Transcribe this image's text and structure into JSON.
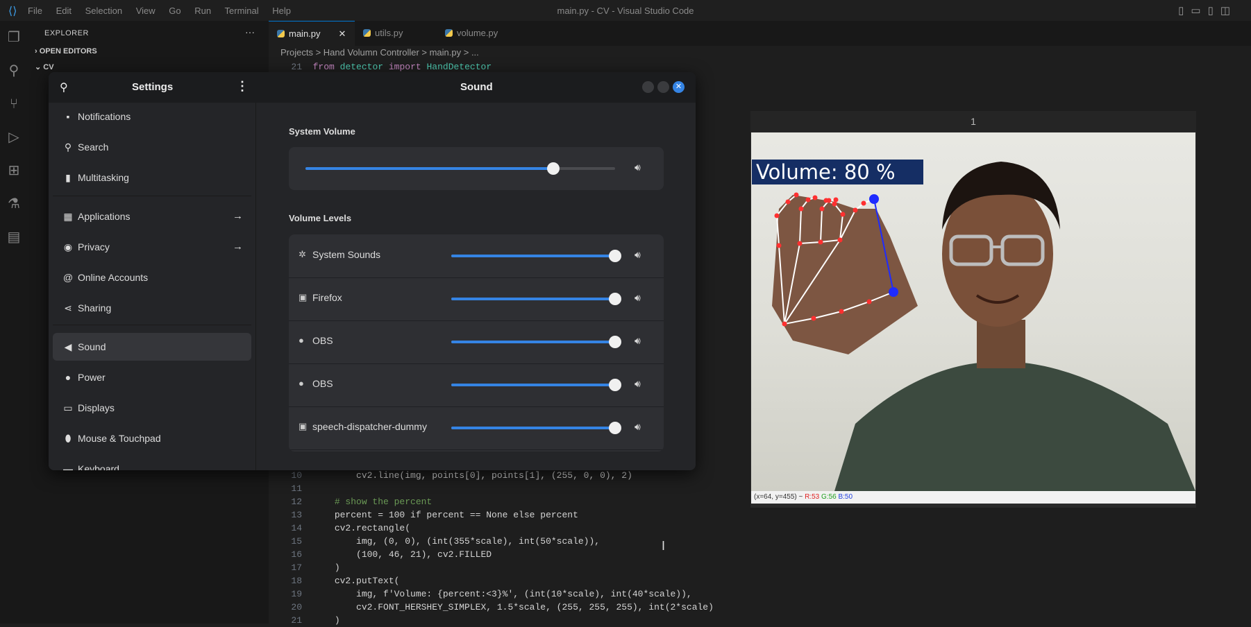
{
  "titlebar": {
    "menu": [
      "File",
      "Edit",
      "Selection",
      "View",
      "Go",
      "Run",
      "Terminal",
      "Help"
    ],
    "title": "main.py - CV - Visual Studio Code"
  },
  "activity_icons": [
    "files-icon",
    "search-icon",
    "source-control-icon",
    "run-debug-icon",
    "extensions-icon",
    "testing-icon",
    "remote-icon"
  ],
  "explorer": {
    "header": "EXPLORER",
    "open_editors": "OPEN EDITORS",
    "folder": "CV"
  },
  "tabs": [
    {
      "label": "main.py",
      "active": true
    },
    {
      "label": "utils.py",
      "active": false
    },
    {
      "label": "volume.py",
      "active": false
    }
  ],
  "breadcrumb": "Projects > Hand Volumn Controller > main.py > ...",
  "code_top": {
    "line": "21",
    "text": "from detector import HandDetector"
  },
  "code_bottom": [
    {
      "n": "10",
      "t": "        cv2.line(img, points[0], points[1], (255, 0, 0), 2)"
    },
    {
      "n": "11",
      "t": ""
    },
    {
      "n": "12",
      "t": "    # show the percent"
    },
    {
      "n": "13",
      "t": "    percent = 100 if percent == None else percent"
    },
    {
      "n": "14",
      "t": "    cv2.rectangle("
    },
    {
      "n": "15",
      "t": "        img, (0, 0), (int(355*scale), int(50*scale)),"
    },
    {
      "n": "16",
      "t": "        (100, 46, 21), cv2.FILLED"
    },
    {
      "n": "17",
      "t": "    )"
    },
    {
      "n": "18",
      "t": "    cv2.putText("
    },
    {
      "n": "19",
      "t": "        img, f'Volume: {percent:<3}%', (int(10*scale), int(40*scale)),"
    },
    {
      "n": "20",
      "t": "        cv2.FONT_HERSHEY_SIMPLEX, 1.5*scale, (255, 255, 255), int(2*scale)"
    },
    {
      "n": "21",
      "t": "    )"
    }
  ],
  "settings": {
    "sidebar_title": "Settings",
    "panel_title": "Sound",
    "sidebar": [
      {
        "label": "Notifications",
        "icon": "notifications-icon",
        "glyph": "▪"
      },
      {
        "label": "Search",
        "icon": "search-icon",
        "glyph": "⚲"
      },
      {
        "label": "Multitasking",
        "icon": "multitasking-icon",
        "glyph": "▮"
      },
      {
        "label": "Applications",
        "icon": "applications-icon",
        "glyph": "▦",
        "arrow": "→"
      },
      {
        "label": "Privacy",
        "icon": "privacy-icon",
        "glyph": "◉",
        "arrow": "→"
      },
      {
        "label": "Online Accounts",
        "icon": "online-accounts-icon",
        "glyph": "@"
      },
      {
        "label": "Sharing",
        "icon": "sharing-icon",
        "glyph": "⋖"
      },
      {
        "label": "Sound",
        "icon": "sound-icon",
        "glyph": "◀",
        "active": true
      },
      {
        "label": "Power",
        "icon": "power-icon",
        "glyph": "●"
      },
      {
        "label": "Displays",
        "icon": "displays-icon",
        "glyph": "▭"
      },
      {
        "label": "Mouse & Touchpad",
        "icon": "mouse-icon",
        "glyph": "⬮"
      },
      {
        "label": "Keyboard",
        "icon": "keyboard-icon",
        "glyph": "▬"
      }
    ],
    "system_volume_title": "System Volume",
    "system_volume_level": 0.8,
    "volume_levels_title": "Volume Levels",
    "levels": [
      {
        "label": "System Sounds",
        "icon": "gear-icon",
        "glyph": "✲",
        "level": 1.0
      },
      {
        "label": "Firefox",
        "icon": "app-icon",
        "glyph": "▣",
        "level": 1.0
      },
      {
        "label": "OBS",
        "icon": "app-dot-icon",
        "glyph": "●",
        "level": 1.0
      },
      {
        "label": "OBS",
        "icon": "app-dot-icon",
        "glyph": "●",
        "level": 1.0
      },
      {
        "label": "speech-dispatcher-dummy",
        "icon": "app-icon",
        "glyph": "▣",
        "level": 1.0
      }
    ],
    "accent_color": "#3584e4"
  },
  "camera": {
    "window_title": "1",
    "overlay_text": "Volume: 80 %",
    "overlay_color": "#152e64",
    "status": {
      "coords": "(x=64, y=455) ~",
      "r": "R:53",
      "g": "G:56",
      "b": "B:50"
    },
    "volume_percent": 80
  }
}
